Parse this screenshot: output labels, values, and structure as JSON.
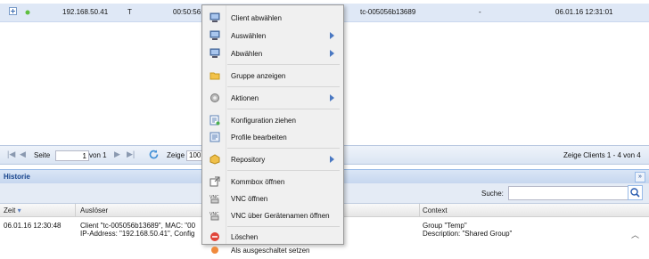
{
  "client_row": {
    "ip": "192.168.50.41",
    "type": "T",
    "mac": "00:50:56:",
    "hostname": "tc-005056b13689",
    "dash": "-",
    "timestamp": "06.01.16 12:31:01"
  },
  "context_menu": {
    "items": [
      {
        "label": "Client abwählen",
        "icon": "client-icon",
        "submenu": false
      },
      {
        "label": "Auswählen",
        "icon": "client-icon",
        "submenu": true
      },
      {
        "label": "Abwählen",
        "icon": "client-icon",
        "submenu": true
      },
      {
        "label": "Gruppe anzeigen",
        "icon": "folder-icon",
        "submenu": false
      },
      {
        "label": "Aktionen",
        "icon": "gear-icon",
        "submenu": true
      },
      {
        "label": "Konfiguration ziehen",
        "icon": "config-pull-icon",
        "submenu": false
      },
      {
        "label": "Profile bearbeiten",
        "icon": "profile-edit-icon",
        "submenu": false
      },
      {
        "label": "Repository",
        "icon": "repository-icon",
        "submenu": true
      },
      {
        "label": "Kommbox öffnen",
        "icon": "external-window-icon",
        "submenu": false
      },
      {
        "label": "VNC öffnen",
        "icon": "vnc-icon",
        "submenu": false
      },
      {
        "label": "VNC über Gerätenamen öffnen",
        "icon": "vnc-icon",
        "submenu": false
      },
      {
        "label": "Löschen",
        "icon": "delete-icon",
        "submenu": false
      },
      {
        "label": "Als ausgeschaltet setzen",
        "icon": "power-off-icon",
        "submenu": false
      }
    ]
  },
  "pager": {
    "seite_label": "Seite",
    "page": "1",
    "von_label": "von 1",
    "zeige_label": "Zeige",
    "page_size": "100 E",
    "summary": "Zeige Clients 1 - 4 von 4"
  },
  "historie": {
    "title": "Historie",
    "search_label": "Suche:",
    "search_value": "",
    "columns": {
      "zeit": "Zeit",
      "ausloeser": "Auslöser",
      "context": "Context"
    },
    "row": {
      "zeit": "06.01.16 12:30:48",
      "ausloeser_line1": "Client \"tc-005056b13689\", MAC: \"00",
      "ausloeser_line2": "IP-Address: \"192.168.50.41\", Config",
      "context_line1": "Group \"Temp\"",
      "context_line2": "Description: \"Shared Group\""
    }
  },
  "colors": {
    "row_selected": "#dfe8f6",
    "panel_header": "#c6d7ef",
    "panel_title": "#15428b",
    "menu_bg": "#f0f0f0",
    "submenu_arrow": "#4a78c2"
  }
}
